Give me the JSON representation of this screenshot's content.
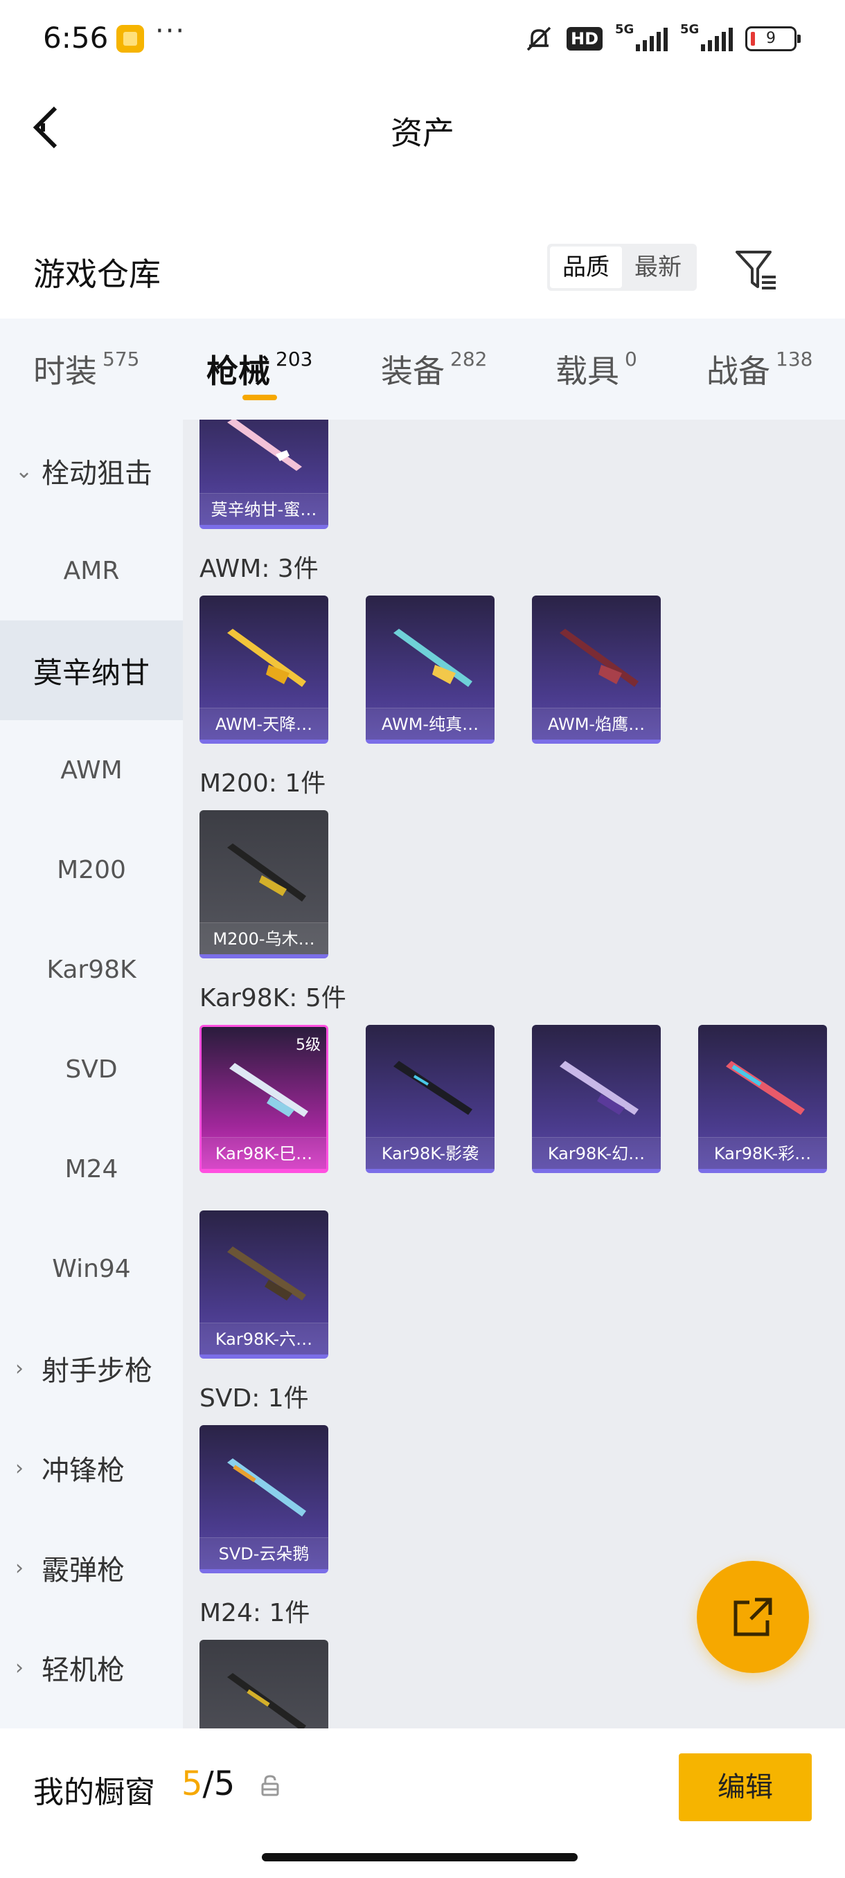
{
  "status_bar": {
    "time": "6:56",
    "battery": "9",
    "network": "5G",
    "network2": "5G",
    "hd_label": "HD"
  },
  "header": {
    "title": "资产"
  },
  "warehouse": {
    "title": "游戏仓库",
    "sort_options": [
      "品质",
      "最新"
    ],
    "active_sort": "品质"
  },
  "tabs": [
    {
      "label": "时装",
      "count": "575"
    },
    {
      "label": "枪械",
      "count": "203"
    },
    {
      "label": "装备",
      "count": "282"
    },
    {
      "label": "载具",
      "count": "0"
    },
    {
      "label": "战备",
      "count": "138"
    }
  ],
  "active_tab": "枪械",
  "sidebar": {
    "items": [
      {
        "label": "栓动狙击",
        "type": "group",
        "icon": "chevron-down-icon"
      },
      {
        "label": "AMR",
        "type": "item"
      },
      {
        "label": "莫辛纳甘",
        "type": "item",
        "selected": true
      },
      {
        "label": "AWM",
        "type": "item"
      },
      {
        "label": "M200",
        "type": "item"
      },
      {
        "label": "Kar98K",
        "type": "item"
      },
      {
        "label": "SVD",
        "type": "item"
      },
      {
        "label": "M24",
        "type": "item"
      },
      {
        "label": "Win94",
        "type": "item"
      },
      {
        "label": "射手步枪",
        "type": "group",
        "icon": "chevron-right-icon"
      },
      {
        "label": "冲锋枪",
        "type": "group",
        "icon": "chevron-right-icon"
      },
      {
        "label": "霰弹枪",
        "type": "group",
        "icon": "chevron-right-icon"
      },
      {
        "label": "轻机枪",
        "type": "group",
        "icon": "chevron-right-icon"
      }
    ]
  },
  "sections": [
    {
      "heading": "",
      "items": [
        {
          "name": "莫辛纳甘-蜜…",
          "rarity": "purple"
        }
      ]
    },
    {
      "heading": "AWM: 3件",
      "items": [
        {
          "name": "AWM-天降…",
          "rarity": "purple"
        },
        {
          "name": "AWM-纯真…",
          "rarity": "purple"
        },
        {
          "name": "AWM-焰鹰…",
          "rarity": "purple"
        }
      ]
    },
    {
      "heading": "M200: 1件",
      "items": [
        {
          "name": "M200-乌木…",
          "rarity": "gray"
        }
      ]
    },
    {
      "heading": "Kar98K: 5件",
      "items": [
        {
          "name": "Kar98K-巳…",
          "rarity": "pink",
          "level": "5级"
        },
        {
          "name": "Kar98K-影袭",
          "rarity": "purple"
        },
        {
          "name": "Kar98K-幻…",
          "rarity": "purple"
        },
        {
          "name": "Kar98K-彩…",
          "rarity": "purple"
        },
        {
          "name": "Kar98K-六…",
          "rarity": "purple"
        }
      ]
    },
    {
      "heading": "SVD: 1件",
      "items": [
        {
          "name": "SVD-云朵鹅",
          "rarity": "purple"
        }
      ]
    },
    {
      "heading": "M24: 1件",
      "items": [
        {
          "name": "",
          "rarity": "gray"
        }
      ]
    }
  ],
  "bottom": {
    "title": "我的橱窗",
    "current": "5",
    "separator": "/",
    "total": "5",
    "edit_label": "编辑"
  },
  "colors": {
    "accent": "#f6a800",
    "purple_card": "#4a3b8c",
    "pink_card": "#d43bc4",
    "gray_card": "#55565e"
  }
}
